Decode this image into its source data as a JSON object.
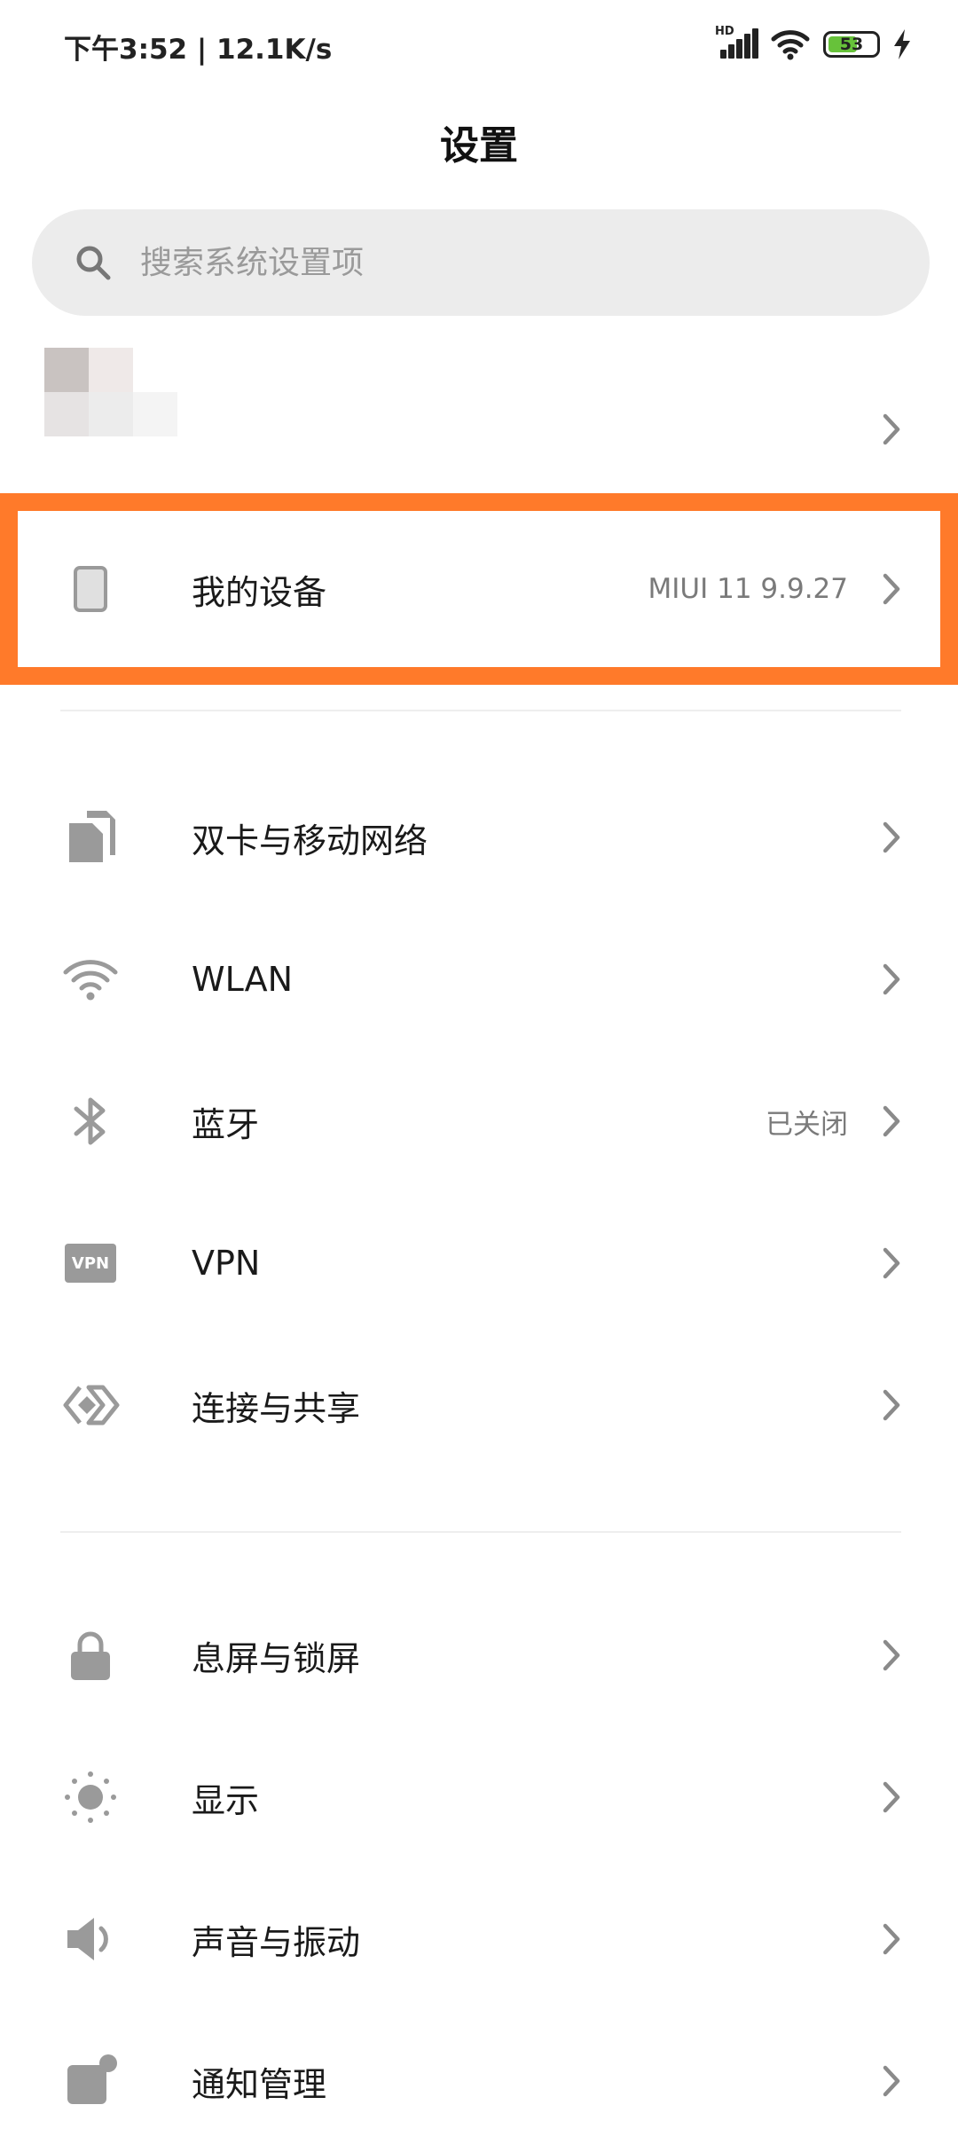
{
  "status_bar": {
    "time_speed": "下午3:52 | 12.1K/s",
    "network_badge": "HD",
    "battery_percent": "53",
    "battery_level": 0.53,
    "icons": [
      "signal-icon",
      "wifi-icon",
      "battery-icon",
      "charging-icon"
    ]
  },
  "header": {
    "title": "设置"
  },
  "search": {
    "placeholder": "搜索系统设置项"
  },
  "account": {
    "chevron": "chevron-right-icon"
  },
  "my_device": {
    "label": "我的设备",
    "value": "MIUI 11 9.9.27",
    "icon": "device-icon",
    "highlight_color": "#ff7a2a"
  },
  "network_section": {
    "items": [
      {
        "label": "双卡与移动网络",
        "value": "",
        "icon": "sim-card-icon"
      },
      {
        "label": "WLAN",
        "value": "",
        "icon": "wifi-icon"
      },
      {
        "label": "蓝牙",
        "value": "已关闭",
        "icon": "bluetooth-icon"
      },
      {
        "label": "VPN",
        "value": "",
        "icon": "vpn-icon",
        "icon_text": "VPN"
      },
      {
        "label": "连接与共享",
        "value": "",
        "icon": "connection-share-icon"
      }
    ]
  },
  "display_section": {
    "items": [
      {
        "label": "息屏与锁屏",
        "value": "",
        "icon": "lock-icon"
      },
      {
        "label": "显示",
        "value": "",
        "icon": "brightness-icon"
      },
      {
        "label": "声音与振动",
        "value": "",
        "icon": "speaker-icon"
      },
      {
        "label": "通知管理",
        "value": "",
        "icon": "notification-icon"
      }
    ]
  },
  "colors": {
    "icon_gray": "#9a9a9a",
    "chevron_gray": "#8a8a8a",
    "highlight": "#ff7a2a",
    "battery_green": "#67c23a"
  }
}
